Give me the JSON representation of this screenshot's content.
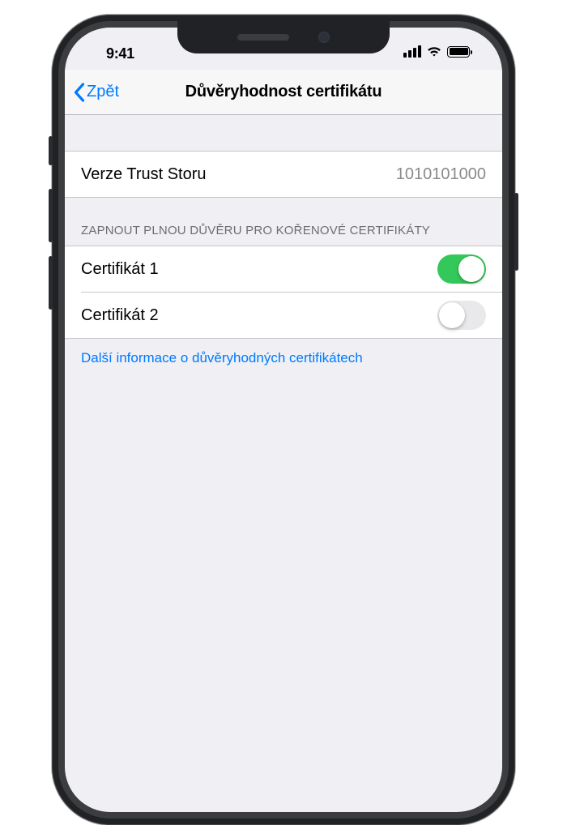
{
  "status": {
    "time": "9:41"
  },
  "nav": {
    "back_label": "Zpět",
    "title": "Důvěryhodnost certifikátu"
  },
  "trust_store": {
    "label": "Verze Trust Storu",
    "value": "1010101000"
  },
  "section_header": "ZAPNOUT PLNOU DŮVĚRU PRO KOŘENOVÉ CERTIFIKÁTY",
  "certs": [
    {
      "label": "Certifikát 1",
      "enabled": true
    },
    {
      "label": "Certifikát 2",
      "enabled": false
    }
  ],
  "footer_link": "Další informace o důvěryhodných certifikátech",
  "colors": {
    "accent": "#007aff",
    "switch_on": "#34c759",
    "bg": "#efeff4"
  }
}
